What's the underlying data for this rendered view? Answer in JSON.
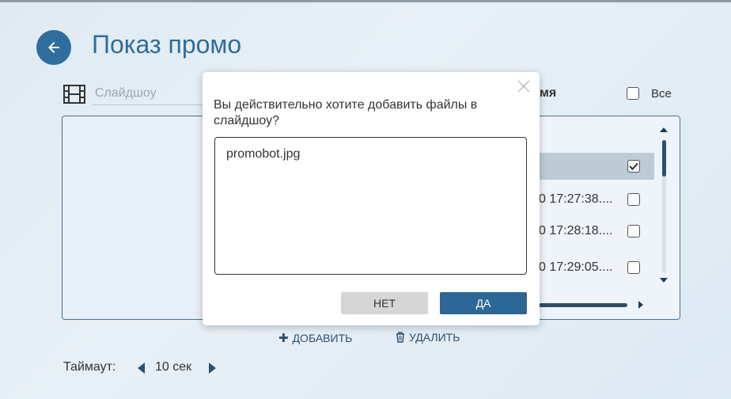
{
  "page": {
    "title": "Показ промо"
  },
  "slideshow": {
    "label": "Слайдшоу"
  },
  "files": {
    "column_header": "мя",
    "all_label": "Все",
    "rows": [
      {
        "text": "",
        "checked": true
      },
      {
        "text": "0 17:27:38....",
        "checked": false
      },
      {
        "text": "0 17:28:18....",
        "checked": false
      },
      {
        "text": "0 17:29:05....",
        "checked": false
      }
    ]
  },
  "actions": {
    "add_label": "ДОБАВИТЬ",
    "delete_label": "УДАЛИТЬ"
  },
  "timeout": {
    "label": "Таймаут:",
    "value": "10 сек"
  },
  "dialog": {
    "question": "Вы действительно хотите добавить файлы в слайдшоу?",
    "files": [
      "promobot.jpg"
    ],
    "no_label": "НЕТ",
    "yes_label": "ДА"
  },
  "colors": {
    "accent": "#2d6e9c",
    "primary_button": "#2d6795",
    "secondary_button": "#d6d6d6",
    "selected_row": "#bccbd6"
  },
  "icons": [
    "back-arrow-icon",
    "film-icon",
    "plus-icon",
    "trash-icon",
    "close-icon",
    "check-icon"
  ]
}
